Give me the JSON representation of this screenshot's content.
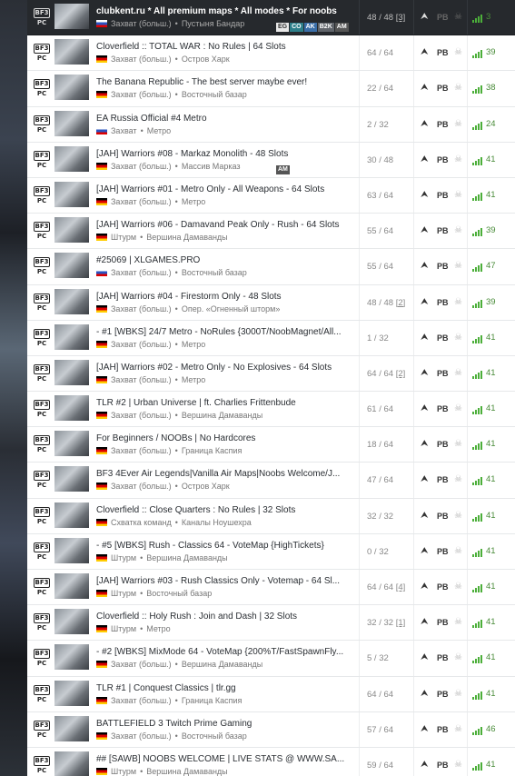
{
  "servers": [
    {
      "name": "clubkent.ru * All premium maps * All modes * For noobs",
      "flag": "ru",
      "mode": "Захват (больш.)",
      "map": "Пустыня Бандар",
      "tags": [
        "EG",
        "CO",
        "AK",
        "B2K",
        "AM"
      ],
      "players": "48 / 48",
      "queue": "[3]",
      "ping": "3",
      "selected": true
    },
    {
      "name": "Cloverfield :: TOTAL WAR : No Rules | 64 Slots",
      "flag": "de",
      "mode": "Захват (больш.)",
      "map": "Остров Харк",
      "tags": [],
      "players": "64 / 64",
      "queue": "",
      "ping": "39"
    },
    {
      "name": "The Banana Republic - The best server maybe ever!",
      "flag": "de",
      "mode": "Захват (больш.)",
      "map": "Восточный базар",
      "tags": [],
      "players": "22 / 64",
      "queue": "",
      "ping": "38"
    },
    {
      "name": "EA Russia Official #4 Metro",
      "flag": "ru",
      "mode": "Захват",
      "map": "Метро",
      "tags": [],
      "players": "2 / 32",
      "queue": "",
      "ping": "24"
    },
    {
      "name": "[JAH] Warriors #08 - Markaz Monolith - 48 Slots",
      "flag": "de",
      "mode": "Захват (больш.)",
      "map": "Массив Марказ",
      "tags": [
        "AM"
      ],
      "players": "30 / 48",
      "queue": "",
      "ping": "41"
    },
    {
      "name": "[JAH] Warriors #01 - Metro Only - All Weapons - 64 Slots",
      "flag": "de",
      "mode": "Захват (больш.)",
      "map": "Метро",
      "tags": [],
      "players": "63 / 64",
      "queue": "",
      "ping": "41"
    },
    {
      "name": "[JAH] Warriors #06 - Damavand Peak Only - Rush - 64 Slots",
      "flag": "de",
      "mode": "Штурм",
      "map": "Вершина Дамаванды",
      "tags": [],
      "players": "55 / 64",
      "queue": "",
      "ping": "39"
    },
    {
      "name": "#25069 | XLGAMES.PRO",
      "flag": "ru",
      "mode": "Захват (больш.)",
      "map": "Восточный базар",
      "tags": [],
      "players": "55 / 64",
      "queue": "",
      "ping": "47"
    },
    {
      "name": "[JAH] Warriors #04 - Firestorm Only - 48 Slots",
      "flag": "de",
      "mode": "Захват (больш.)",
      "map": "Опер. «Огненный шторм»",
      "tags": [],
      "players": "48 / 48",
      "queue": "[2]",
      "ping": "39"
    },
    {
      "name": "- #1 [WBKS] 24/7 Metro - NoRules {3000T/NoobMagnet/All...",
      "flag": "de",
      "mode": "Захват (больш.)",
      "map": "Метро",
      "tags": [],
      "players": "1 / 32",
      "queue": "",
      "ping": "41"
    },
    {
      "name": "[JAH] Warriors #02 - Metro Only - No Explosives - 64 Slots",
      "flag": "de",
      "mode": "Захват (больш.)",
      "map": "Метро",
      "tags": [],
      "players": "64 / 64",
      "queue": "[2]",
      "ping": "41"
    },
    {
      "name": "TLR #2 | Urban Universe | ft. Charlies Frittenbude",
      "flag": "de",
      "mode": "Захват (больш.)",
      "map": "Вершина Дамаванды",
      "tags": [],
      "players": "61 / 64",
      "queue": "",
      "ping": "41"
    },
    {
      "name": "For Beginners / NOOBs | No Hardcores",
      "flag": "de",
      "mode": "Захват (больш.)",
      "map": "Граница Каспия",
      "tags": [],
      "players": "18 / 64",
      "queue": "",
      "ping": "41"
    },
    {
      "name": "BF3 4Ever Air Legends|Vanilla Air Maps|Noobs Welcome/J...",
      "flag": "de",
      "mode": "Захват (больш.)",
      "map": "Остров Харк",
      "tags": [],
      "players": "47 / 64",
      "queue": "",
      "ping": "41"
    },
    {
      "name": "Cloverfield :: Close Quarters : No Rules | 32 Slots",
      "flag": "de",
      "mode": "Схватка команд",
      "map": "Каналы Ноушехра",
      "tags": [],
      "players": "32 / 32",
      "queue": "",
      "ping": "41"
    },
    {
      "name": "- #5 [WBKS] Rush - Classics 64 - VoteMap {HighTickets}",
      "flag": "de",
      "mode": "Штурм",
      "map": "Вершина Дамаванды",
      "tags": [],
      "players": "0 / 32",
      "queue": "",
      "ping": "41"
    },
    {
      "name": "[JAH] Warriors #03 - Rush Classics Only - Votemap - 64 Sl...",
      "flag": "de",
      "mode": "Штурм",
      "map": "Восточный базар",
      "tags": [],
      "players": "64 / 64",
      "queue": "[4]",
      "ping": "41"
    },
    {
      "name": "Cloverfield :: Holy Rush : Join and Dash | 32 Slots",
      "flag": "de",
      "mode": "Штурм",
      "map": "Метро",
      "tags": [],
      "players": "32 / 32",
      "queue": "[1]",
      "ping": "41"
    },
    {
      "name": "- #2 [WBKS] MixMode 64 - VoteMap {200%T/FastSpawnFly...",
      "flag": "de",
      "mode": "Захват (больш.)",
      "map": "Вершина Дамаванды",
      "tags": [],
      "players": "5 / 32",
      "queue": "",
      "ping": "41"
    },
    {
      "name": "TLR #1 | Conquest Classics | tlr.gg",
      "flag": "de",
      "mode": "Захват (больш.)",
      "map": "Граница Каспия",
      "tags": [],
      "players": "64 / 64",
      "queue": "",
      "ping": "41"
    },
    {
      "name": "BATTLEFIELD 3 Twitch Prime Gaming",
      "flag": "de",
      "mode": "Захват (больш.)",
      "map": "Восточный базар",
      "tags": [],
      "players": "57 / 64",
      "queue": "",
      "ping": "46"
    },
    {
      "name": "## [SAWB] NOOBS WELCOME | LIVE STATS @ WWW.SA...",
      "flag": "de",
      "mode": "Штурм",
      "map": "Вершина Дамаванды",
      "tags": [],
      "players": "59 / 64",
      "queue": "",
      "ping": "41"
    }
  ],
  "labels": {
    "platform_top": "BF3",
    "platform_bottom": "PC",
    "pb": "PB"
  }
}
